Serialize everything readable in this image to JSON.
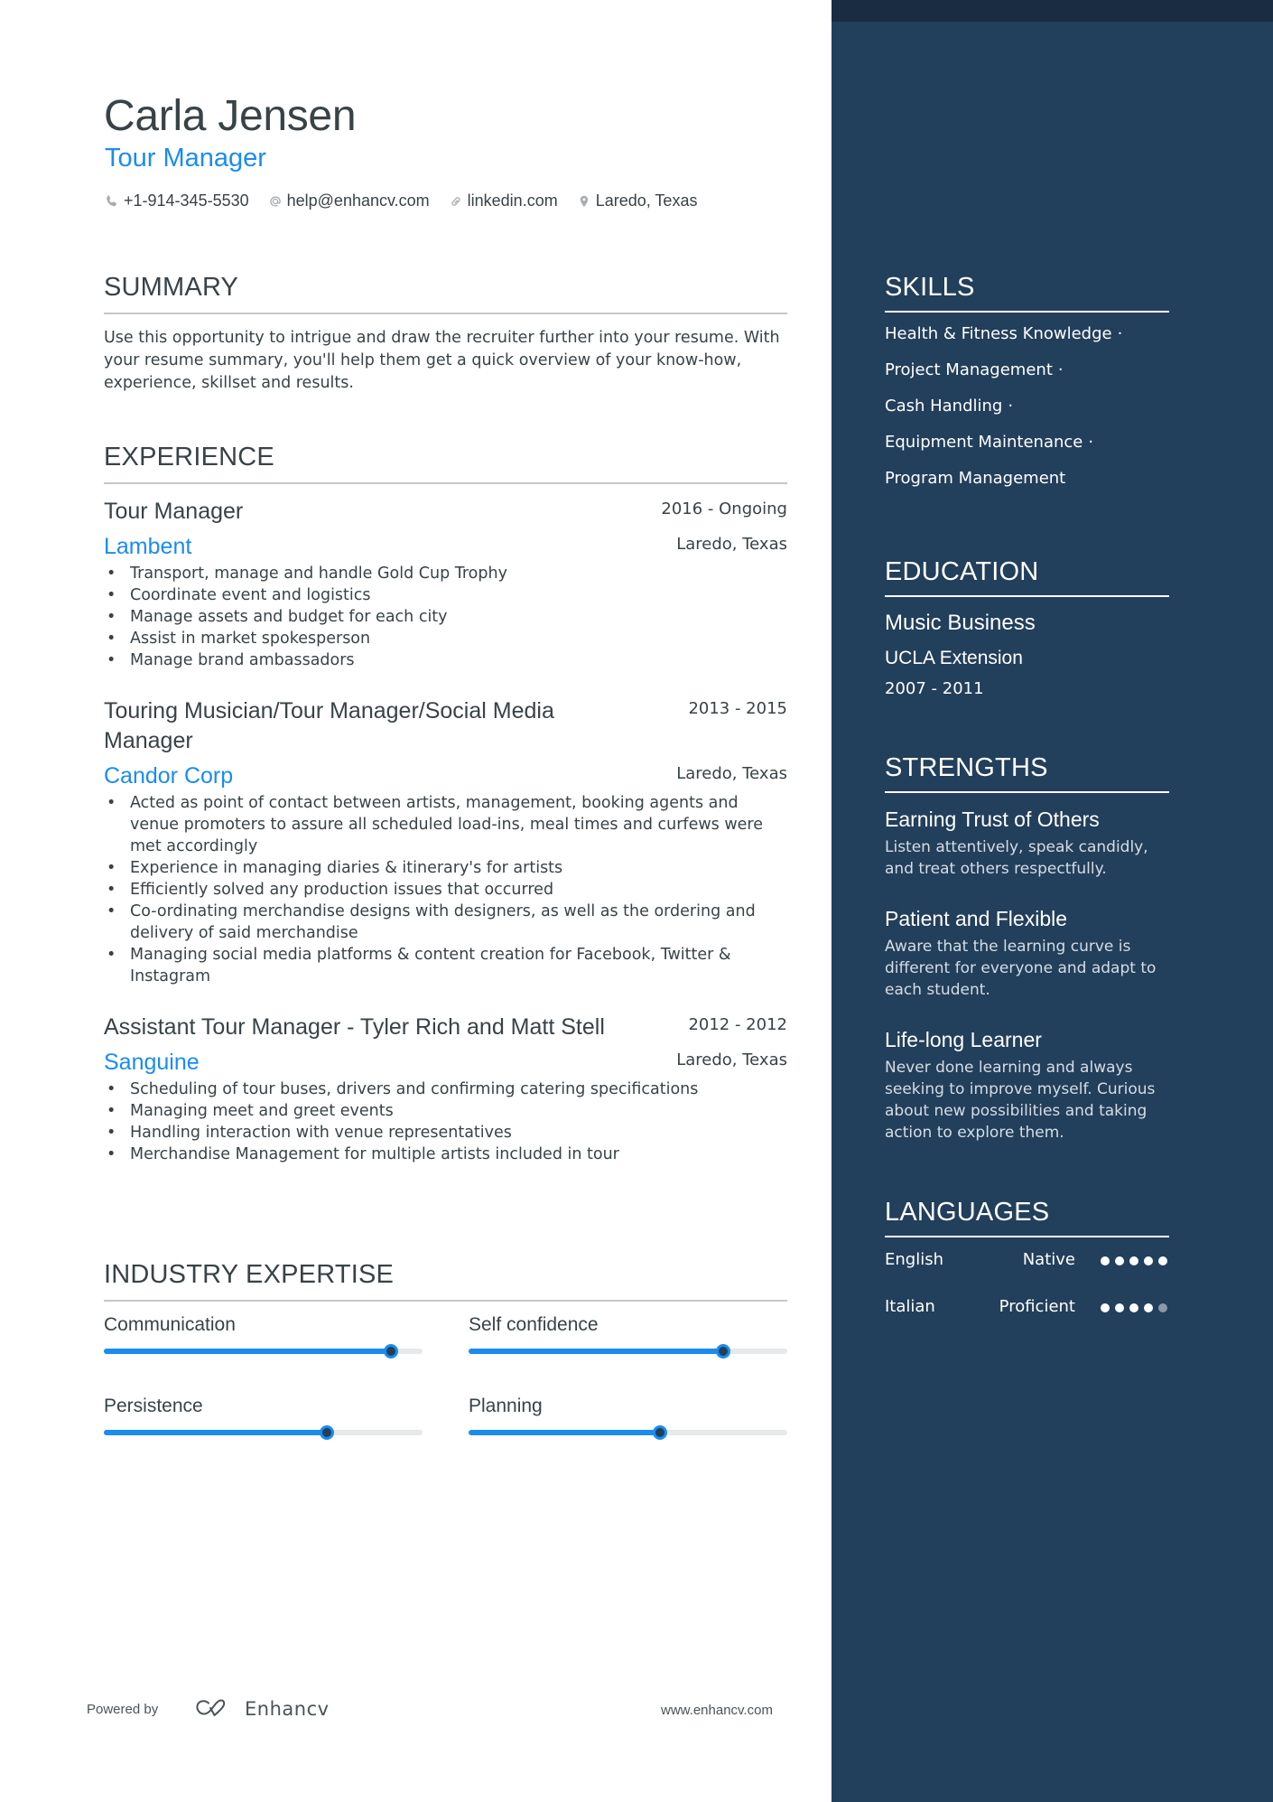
{
  "header": {
    "name": "Carla Jensen",
    "role": "Tour Manager",
    "contacts": [
      {
        "icon": "phone-icon",
        "text": "+1-914-345-5530"
      },
      {
        "icon": "at-icon",
        "text": "help@enhancv.com"
      },
      {
        "icon": "link-icon",
        "text": "linkedin.com"
      },
      {
        "icon": "location-pin-icon",
        "text": "Laredo, Texas"
      }
    ]
  },
  "summary": {
    "heading": "SUMMARY",
    "text": "Use this opportunity to intrigue and draw the recruiter further into your resume. With your resume summary, you'll help them get a quick overview of your know-how, experience, skillset and results."
  },
  "experience": {
    "heading": "EXPERIENCE",
    "jobs": [
      {
        "title": "Tour Manager",
        "dates": "2016 - Ongoing",
        "company": "Lambent",
        "location": "Laredo, Texas",
        "bullets": [
          "Transport, manage and handle Gold Cup Trophy",
          "Coordinate event and logistics",
          "Manage assets and budget for each city",
          "Assist in market spokesperson",
          "Manage brand ambassadors"
        ]
      },
      {
        "title": "Touring Musician/Tour Manager/Social Media Manager",
        "dates": "2013 - 2015",
        "company": "Candor Corp",
        "location": "Laredo, Texas",
        "bullets": [
          "Acted as point of contact between artists, management, booking agents and venue promoters to assure all scheduled load-ins, meal times and curfews were met accordingly",
          "Experience in managing diaries & itinerary's for artists",
          "Efficiently solved any production issues that occurred",
          "Co-ordinating merchandise designs with designers, as well as the ordering and delivery of said merchandise",
          "Managing social media platforms & content creation for Facebook, Twitter & Instagram"
        ]
      },
      {
        "title": "Assistant Tour Manager - Tyler Rich and Matt Stell",
        "dates": "2012 - 2012",
        "company": "Sanguine",
        "location": "Laredo, Texas",
        "bullets": [
          "Scheduling of tour buses, drivers and confirming catering specifications",
          "Managing meet and greet events",
          "Handling interaction with venue representatives",
          "Merchandise Management for multiple artists included in tour"
        ]
      }
    ]
  },
  "industry_expertise": {
    "heading": "INDUSTRY EXPERTISE",
    "items": [
      {
        "label": "Communication",
        "level": 0.9
      },
      {
        "label": "Self confidence",
        "level": 0.8
      },
      {
        "label": "Persistence",
        "level": 0.7
      },
      {
        "label": "Planning",
        "level": 0.6
      }
    ]
  },
  "skills": {
    "heading": "SKILLS",
    "items": [
      "Health & Fitness Knowledge",
      "Project Management",
      "Cash Handling",
      "Equipment Maintenance",
      "Program Management"
    ],
    "separator": "·"
  },
  "education": {
    "heading": "EDUCATION",
    "degree": "Music Business",
    "school": "UCLA Extension",
    "dates": "2007 - 2011"
  },
  "strengths": {
    "heading": "STRENGTHS",
    "items": [
      {
        "title": "Earning Trust of Others",
        "description": "Listen attentively, speak candidly, and treat others respectfully."
      },
      {
        "title": "Patient and Flexible",
        "description": "Aware that the learning curve is different for everyone and adapt to each student."
      },
      {
        "title": "Life-long Learner",
        "description": "Never done learning and always seeking to improve myself. Curious about new possibilities and taking action to explore them."
      }
    ]
  },
  "languages": {
    "heading": "LANGUAGES",
    "items": [
      {
        "name": "English",
        "level": "Native",
        "dots_filled": 5,
        "dots_total": 5
      },
      {
        "name": "Italian",
        "level": "Proficient",
        "dots_filled": 4,
        "dots_total": 5
      }
    ]
  },
  "footer": {
    "powered_by": "Powered by",
    "brand": "Enhancv",
    "url": "www.enhancv.com"
  },
  "colors": {
    "accent": "#1a8cf0",
    "sidebar": "#223f5b",
    "sidebar_topband": "#1a2c42",
    "text": "#384347"
  }
}
